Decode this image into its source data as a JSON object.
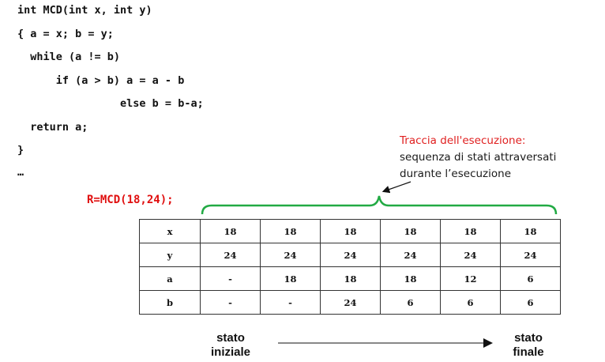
{
  "code": {
    "lines": [
      "int MCD(int x, int y)",
      "{ a = x; b = y;",
      "  while (a != b)",
      "      if (a > b) a = a - b",
      "                else b = b-a;",
      "  return a;",
      "}",
      "…"
    ],
    "call": "R=MCD(18,24);"
  },
  "annotation": {
    "title": "Traccia dell'esecuzione:",
    "line1": "sequenza di stati attraversati",
    "line2": "durante l’esecuzione"
  },
  "trace_table": {
    "rows": [
      {
        "var": "x",
        "values": [
          "18",
          "18",
          "18",
          "18",
          "18",
          "18"
        ]
      },
      {
        "var": "y",
        "values": [
          "24",
          "24",
          "24",
          "24",
          "24",
          "24"
        ]
      },
      {
        "var": "a",
        "values": [
          "-",
          "18",
          "18",
          "18",
          "12",
          "6"
        ]
      },
      {
        "var": "b",
        "values": [
          "-",
          "-",
          "24",
          "6",
          "6",
          "6"
        ]
      }
    ]
  },
  "states": {
    "initial_line1": "stato",
    "initial_line2": "iniziale",
    "final_line1": "stato",
    "final_line2": "finale"
  },
  "colors": {
    "brace": "#22aa44",
    "call_text": "#e01010",
    "annotation_title": "#e02020"
  }
}
